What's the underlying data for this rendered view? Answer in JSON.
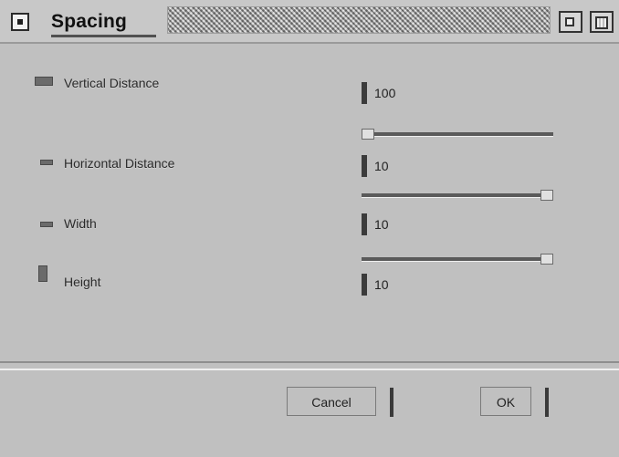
{
  "window": {
    "title": "Spacing"
  },
  "fields": [
    {
      "label": "Vertical Distance",
      "value": "100"
    },
    {
      "label": "Horizontal Distance",
      "value": "10"
    },
    {
      "label": "Width",
      "value": "10"
    },
    {
      "label": "Height",
      "value": "10"
    }
  ],
  "buttons": {
    "cancel": "Cancel",
    "ok": "OK"
  },
  "sliders": [
    {
      "level_percent": 0
    },
    {
      "level_percent": 100
    },
    {
      "level_percent": 100
    }
  ],
  "icons": {
    "close": "close-icon",
    "iconify": "iconify-icon",
    "maximize": "maximize-icon"
  }
}
